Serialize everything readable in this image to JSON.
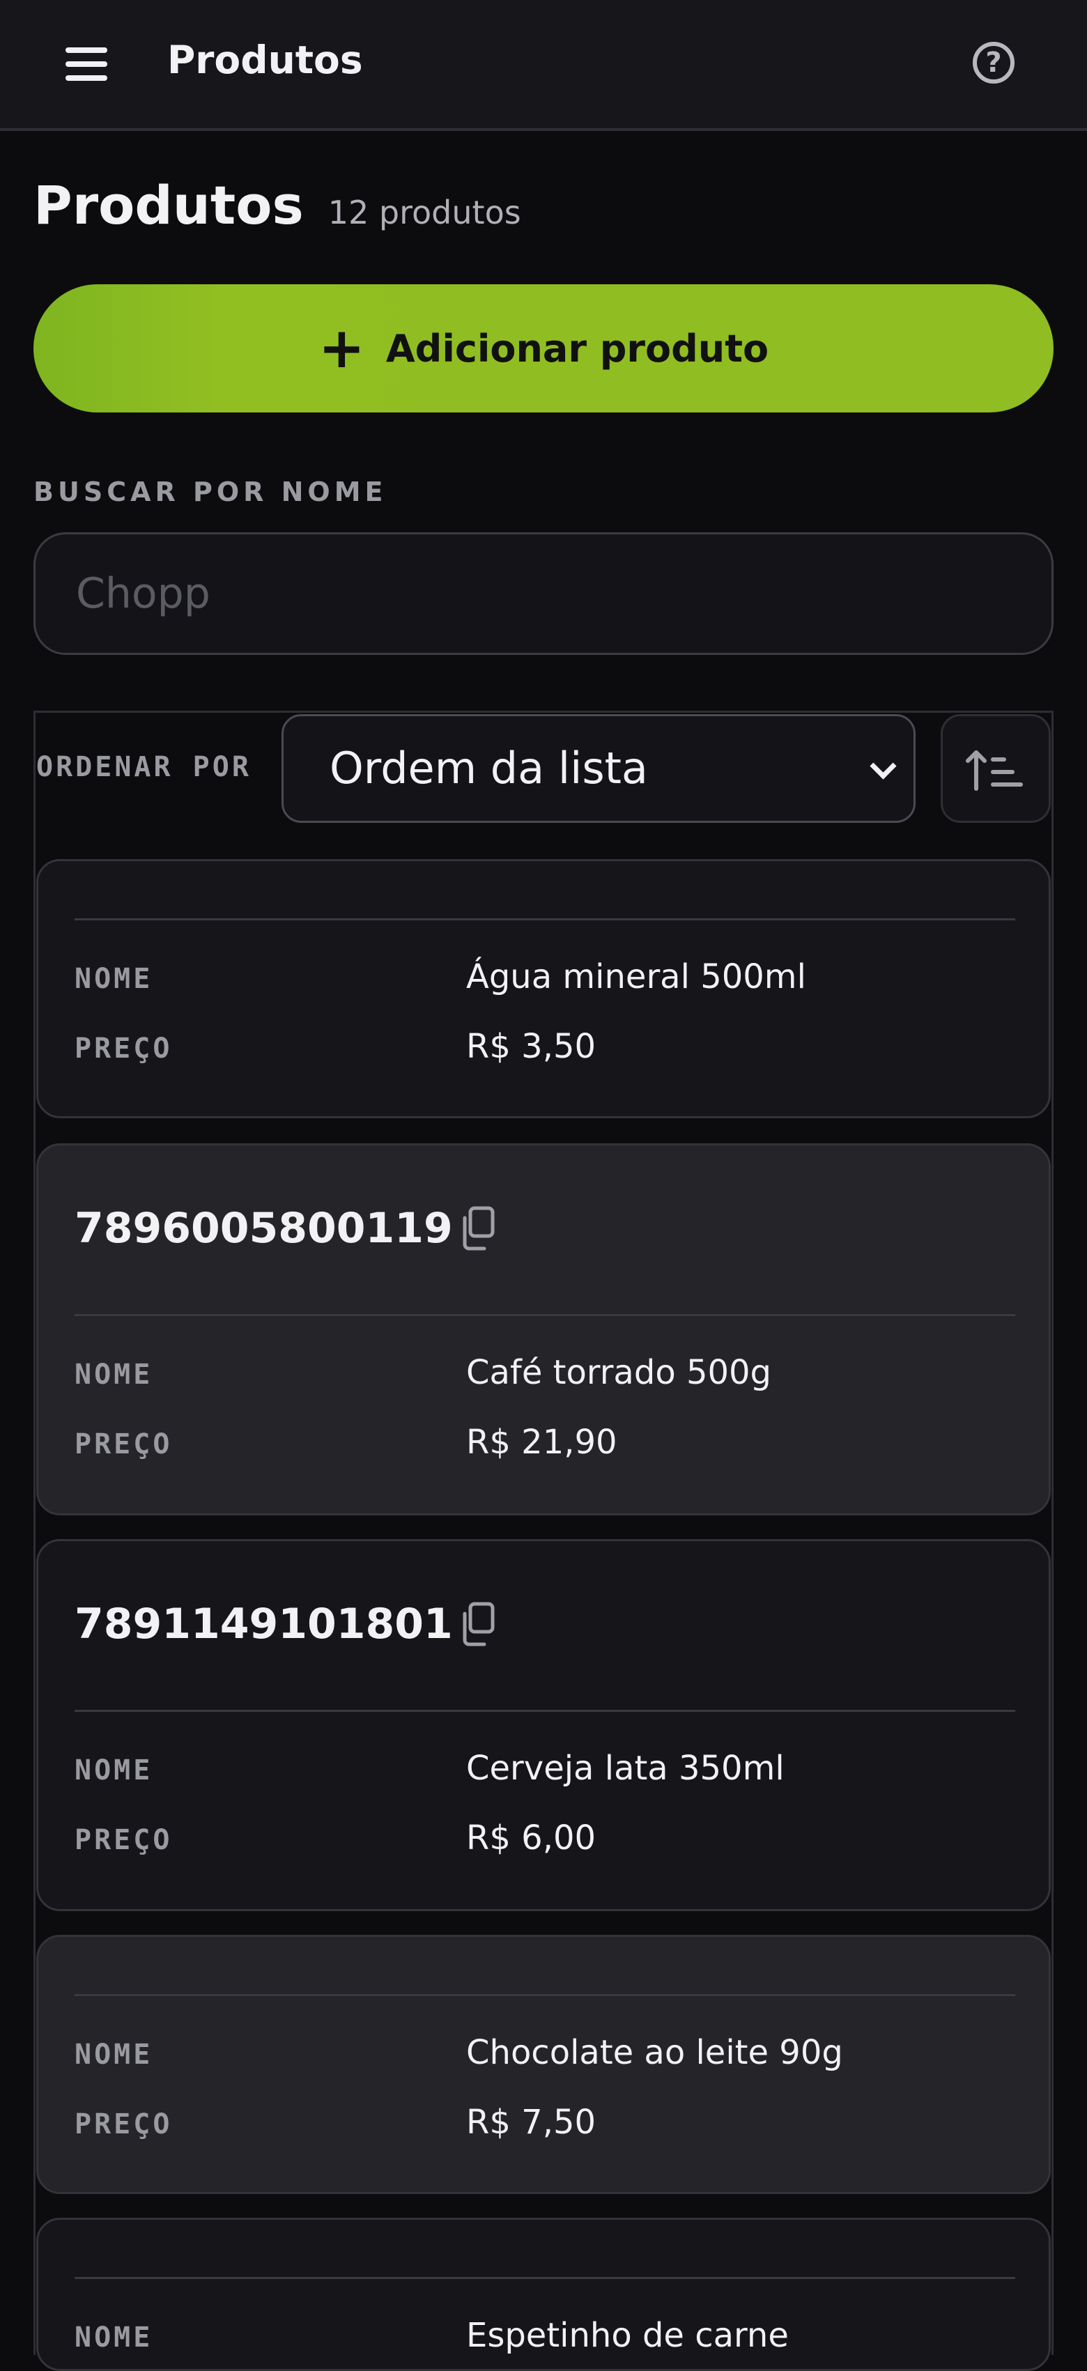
{
  "topbar": {
    "title": "Produtos",
    "menu_icon": "hamburger-menu-icon",
    "help_icon": "help-circle-icon",
    "help_glyph": "?"
  },
  "heading": {
    "title": "Produtos",
    "count": "12 produtos"
  },
  "add_button": {
    "plus": "+",
    "label": "Adicionar produto"
  },
  "search": {
    "label": "BUSCAR POR NOME",
    "placeholder": "Chopp"
  },
  "sort": {
    "label": "ORDENAR POR",
    "selected": "Ordem da lista",
    "order_icon": "sort-ascending-icon"
  },
  "field_labels": {
    "name": "NOME",
    "price": "PREÇO"
  },
  "products": [
    {
      "barcode": "",
      "name": "Água mineral 500ml",
      "price": "R$ 3,50"
    },
    {
      "barcode": "7896005800119",
      "name": "Café torrado 500g",
      "price": "R$ 21,90"
    },
    {
      "barcode": "7891149101801",
      "name": "Cerveja lata 350ml",
      "price": "R$ 6,00"
    },
    {
      "barcode": "",
      "name": "Chocolate ao leite 90g",
      "price": "R$ 7,50"
    },
    {
      "barcode": "",
      "name": "Espetinho de carne",
      "price": ""
    }
  ],
  "colors": {
    "accent": "#8fbd22",
    "background": "#0c0c0f",
    "card": "#15151a",
    "card_alt": "#242429"
  }
}
